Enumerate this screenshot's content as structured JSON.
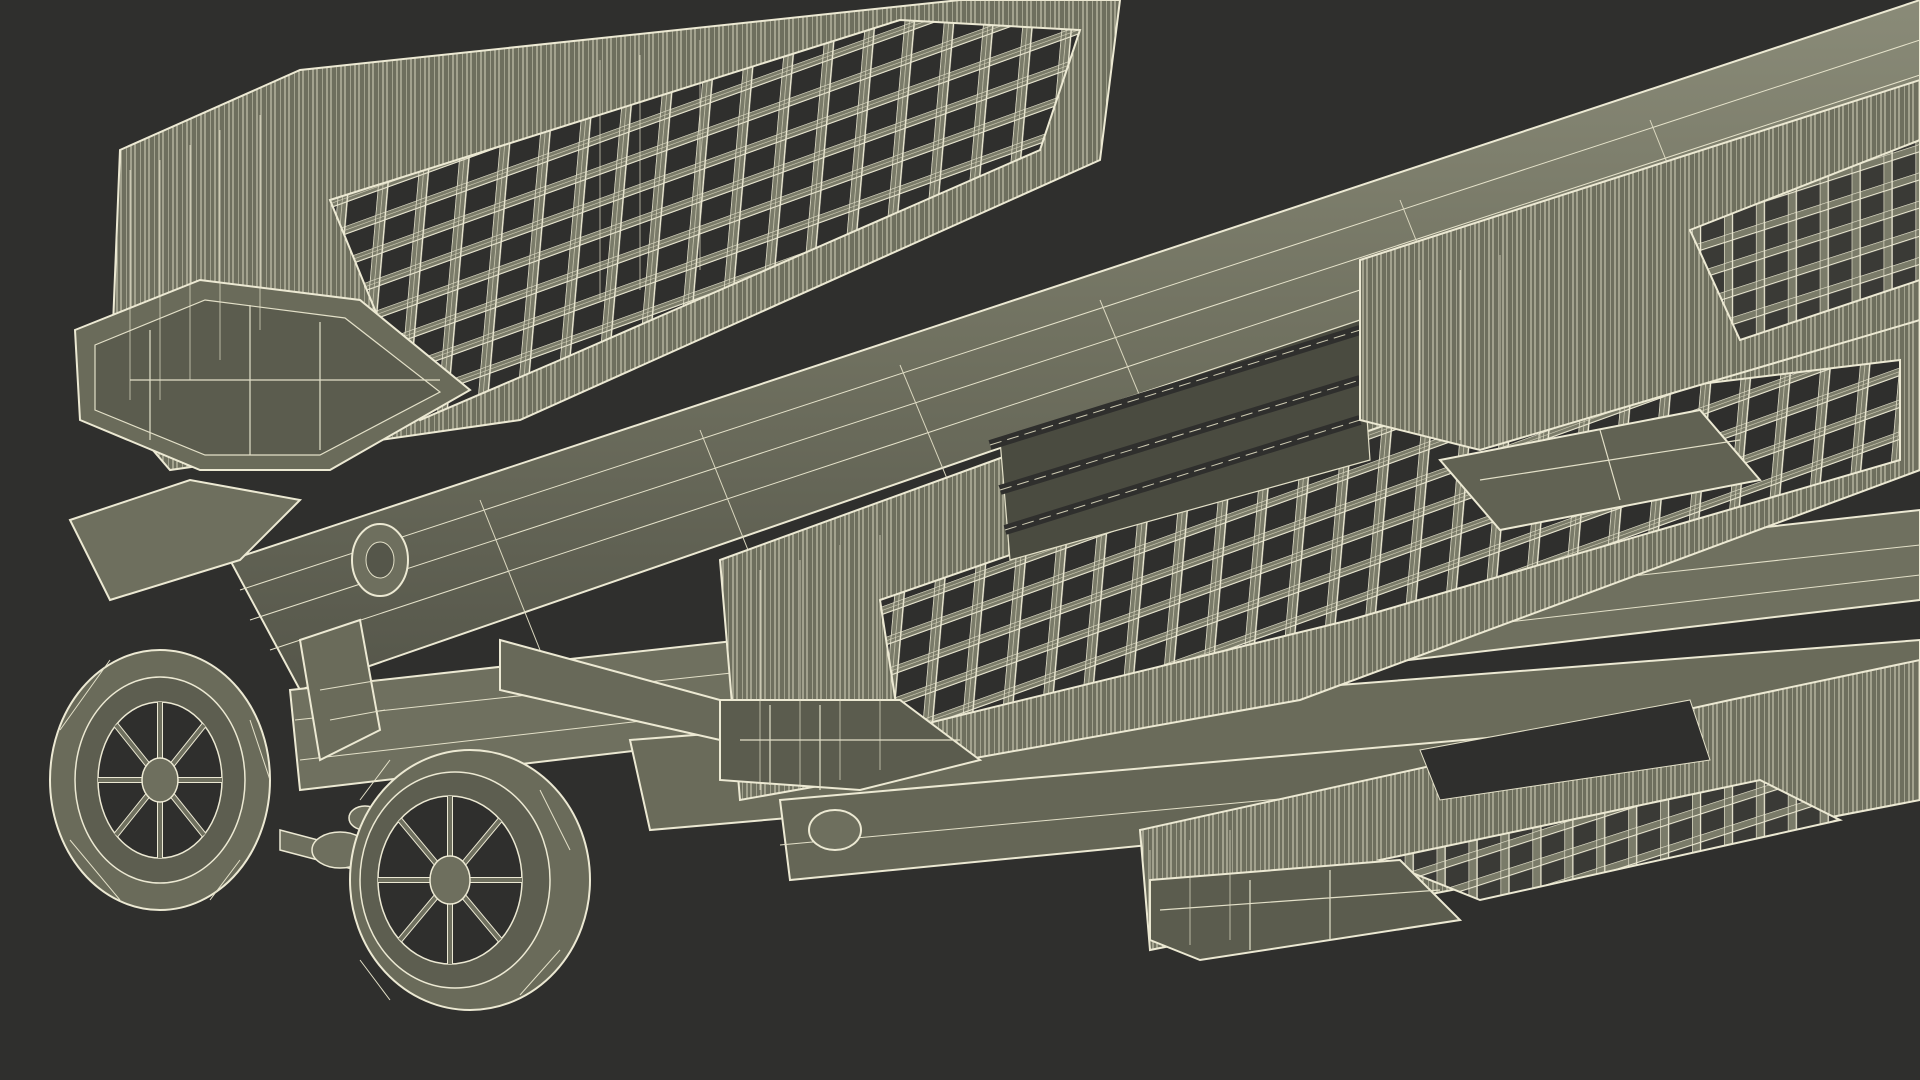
{
  "viewport": {
    "background": "#2f2f2d",
    "model_fill": "#6f705f",
    "model_fill_light": "#80816f",
    "model_fill_dark": "#56574a",
    "wire_color": "#e9e6cf",
    "wire_color_dim": "#c9c6ad"
  }
}
